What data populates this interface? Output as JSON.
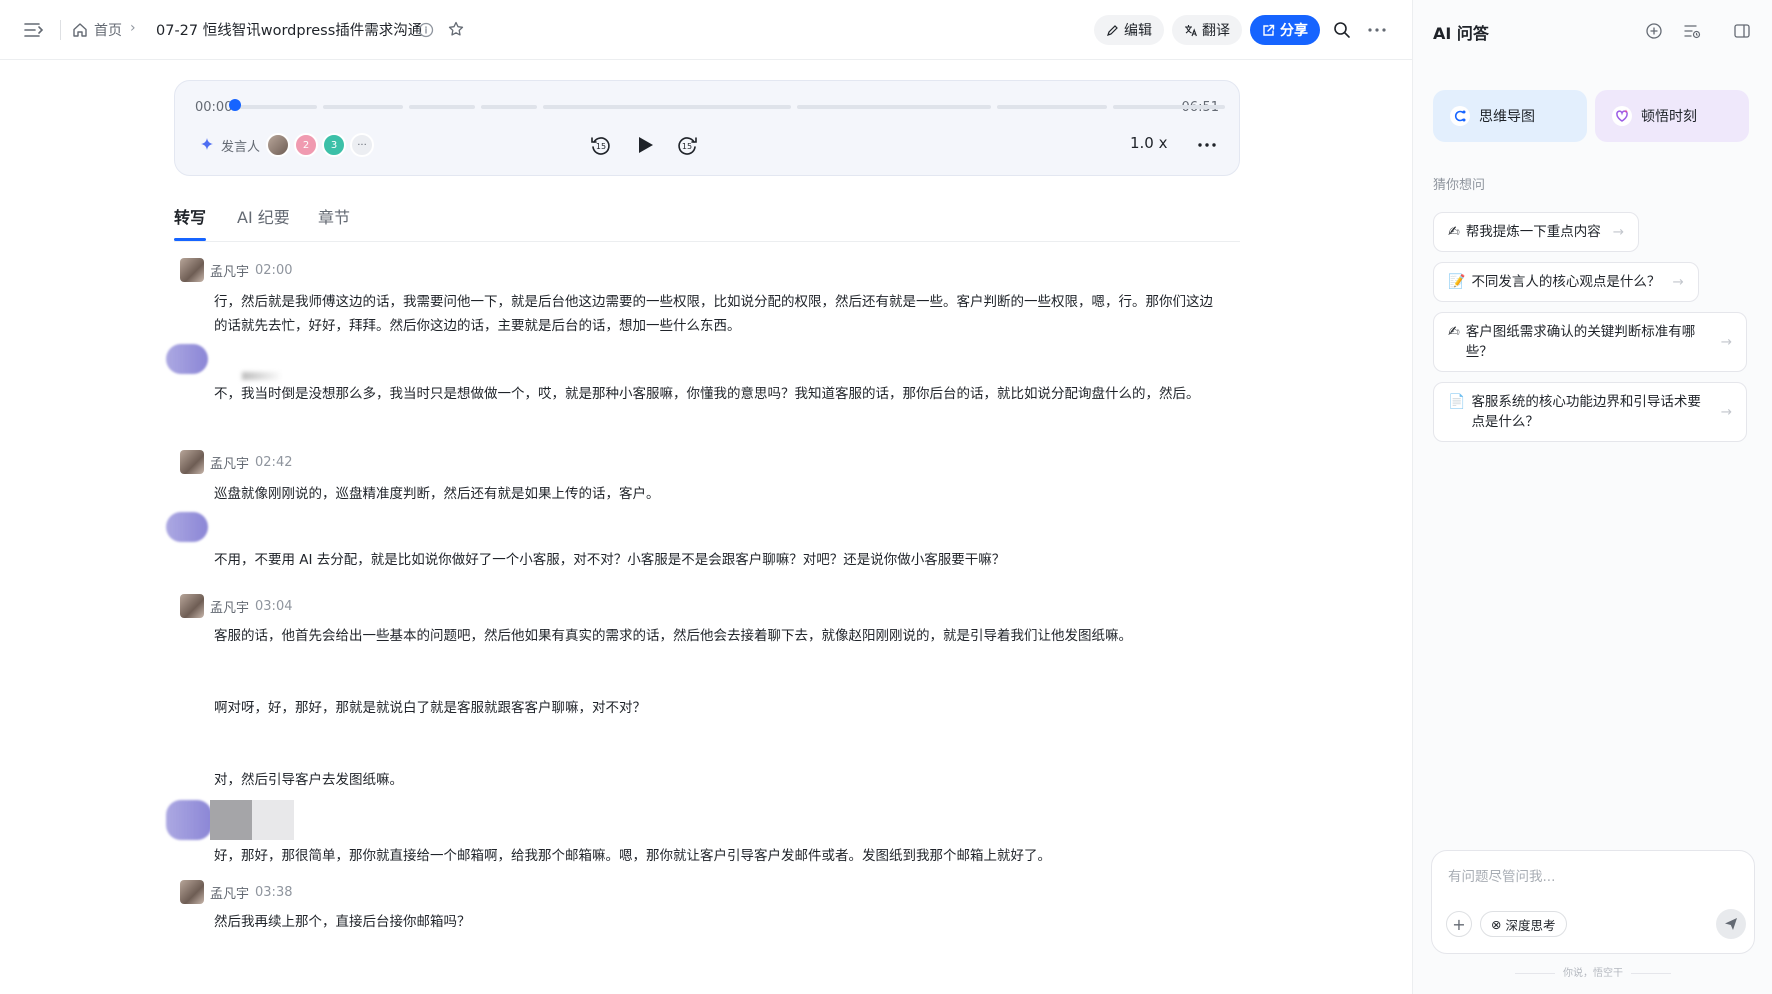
{
  "header": {
    "breadcrumb_home": "首页",
    "doc_title": "07-27 恒线智讯wordpress插件需求沟通",
    "edit_label": "编辑",
    "translate_label": "翻译",
    "share_label": "分享"
  },
  "player": {
    "time_current": "00:00",
    "time_total": "06:51",
    "speaker_label": "发言人",
    "speaker_badges": [
      "2",
      "3"
    ],
    "skip_back": "15",
    "skip_forward": "15",
    "speed": "1.0 x"
  },
  "tabs": [
    "转写",
    "AI 纪要",
    "章节"
  ],
  "transcript": [
    {
      "speaker": "孟凡宇",
      "time": "02:00",
      "text": "行，然后就是我师傅这边的话，我需要问他一下，就是后台他这边需要的一些权限，比如说分配的权限，然后还有就是一些。客户判断的一些权限，嗯，行。那你们这边的话就先去忙，好好，拜拜。然后你这边的话，主要就是后台的话，想加一些什么东西。"
    },
    {
      "speaker": "",
      "time": "",
      "text": "不，我当时倒是没想那么多，我当时只是想做做一个，哎，就是那种小客服嘛，你懂我的意思吗？我知道客服的话，那你后台的话，就比如说分配询盘什么的，然后。"
    },
    {
      "speaker": "孟凡宇",
      "time": "02:42",
      "text": "巡盘就像刚刚说的，巡盘精准度判断，然后还有就是如果上传的话，客户。"
    },
    {
      "speaker": "",
      "time": "",
      "text": "不用，不要用 AI 去分配，就是比如说你做好了一个小客服，对不对？小客服是不是会跟客户聊嘛？对吧？还是说你做小客服要干嘛？"
    },
    {
      "speaker": "孟凡宇",
      "time": "03:04",
      "text": "客服的话，他首先会给出一些基本的问题吧，然后他如果有真实的需求的话，然后他会去接着聊下去，就像赵阳刚刚说的，就是引导着我们让他发图纸嘛。"
    },
    {
      "speaker": "",
      "time": "",
      "text": "啊对呀，好，那好，那就是就说白了就是客服就跟客客户聊嘛，对不对？"
    },
    {
      "speaker": "",
      "time": "",
      "text": "对，然后引导客户去发图纸嘛。"
    },
    {
      "speaker": "",
      "time": "",
      "text": "好，那好，那很简单，那你就直接给一个邮箱啊，给我那个邮箱嘛。嗯，那你就让客户引导客户发邮件或者。发图纸到我那个邮箱上就好了。"
    },
    {
      "speaker": "孟凡宇",
      "time": "03:38",
      "text": "然后我再续上那个，直接后台接你邮箱吗？"
    }
  ],
  "panel": {
    "title": "AI 问答",
    "mind_map": "思维导图",
    "aha_moment": "顿悟时刻",
    "guess_label": "猜你想问",
    "suggestions": [
      "帮我提炼一下重点内容",
      "不同发言人的核心观点是什么？",
      "客户图纸需求确认的关键判断标准有哪些？",
      "客服系统的核心功能边界和引导话术要点是什么？"
    ],
    "input_placeholder": "有问题尽管问我...",
    "deep_think": "深度思考",
    "footer": "你说，悟空干"
  },
  "colors": {
    "accent": "#1664ff",
    "player_bg": "#f4f6fb",
    "mind_map_bg": "#e3effd",
    "aha_bg": "#efe8fb"
  },
  "icons": [
    "menu-icon",
    "home-icon",
    "info-icon",
    "star-icon",
    "edit-icon",
    "translate-icon",
    "share-icon",
    "search-icon",
    "more-icon",
    "sparkle-icon",
    "rewind-15-icon",
    "play-icon",
    "forward-15-icon",
    "new-chat-icon",
    "history-icon",
    "panel-toggle-icon",
    "mind-map-icon",
    "aha-icon",
    "send-icon"
  ]
}
